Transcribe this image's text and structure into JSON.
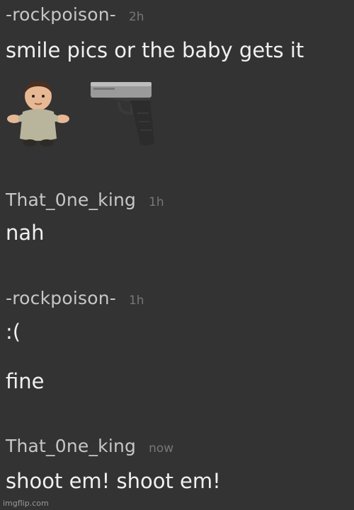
{
  "messages": [
    {
      "username": "-rockpoison-",
      "time": "2h",
      "lines": [
        "smile pics or the baby gets it"
      ],
      "emojis": [
        "baby-emoji-icon",
        "pistol-emoji-icon"
      ]
    },
    {
      "username": "That_0ne_king",
      "time": "1h",
      "lines": [
        "nah"
      ]
    },
    {
      "username": "-rockpoison-",
      "time": "1h",
      "lines": [
        ":(",
        "fine"
      ]
    },
    {
      "username": "That_0ne_king",
      "time": "now",
      "lines": [
        "shoot em! shoot em!"
      ]
    }
  ],
  "watermark": "imgflip.com",
  "colors": {
    "background": "#333333",
    "username": "#c7c7c7",
    "timestamp": "#777777",
    "message": "#f0f0f0"
  }
}
